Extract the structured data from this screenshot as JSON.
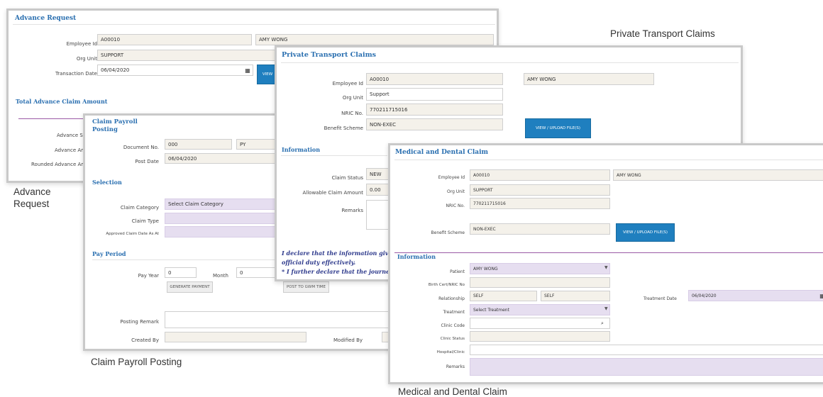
{
  "captions": {
    "advance": "Advance\nRequest",
    "private": "Private Transport Claims",
    "payroll": "Claim Payroll Posting",
    "medical": "Medical and Dental Claim"
  },
  "advance": {
    "title": "Advance Request",
    "employee_id_label": "Employee Id",
    "employee_id": "A00010",
    "employee_name": "AMY WONG",
    "org_unit_label": "Org Unit",
    "org_unit": "SUPPORT",
    "transaction_date_label": "Transaction Date",
    "transaction_date": "06/04/2020",
    "view_button": "VIEW",
    "total_section": "Total Advance Claim Amount",
    "advance_status_label": "Advance Sta",
    "advance_amount_label": "Advance Amo",
    "rounded_label": "Rounded Advance Amo"
  },
  "payroll": {
    "title_line1": "Claim Payroll",
    "title_line2": "Posting",
    "document_no_label": "Document No.",
    "document_no": "000",
    "document_type": "PY",
    "post_date_label": "Post Date",
    "post_date": "06/04/2020",
    "selection_section": "Selection",
    "claim_category_label": "Claim Category",
    "claim_category": "Select Claim Category",
    "claim_type_label": "Claim Type",
    "approved_date_label": "Approved Claim Date As At",
    "pay_period_section": "Pay Period",
    "pay_year_label": "Pay Year",
    "pay_year": "0",
    "month_label": "Month",
    "month": "0",
    "generate_button": "GENERATE PAYMENT",
    "post_button": "POST TO GWM TIME",
    "posting_remark_label": "Posting Remark",
    "created_by_label": "Created By",
    "modified_by_label": "Modified By"
  },
  "private": {
    "title": "Private Transport Claims",
    "employee_id_label": "Employee Id",
    "employee_id": "A00010",
    "employee_name": "AMY WONG",
    "org_unit_label": "Org Unit",
    "org_unit": "Support",
    "nric_label": "NRIC No.",
    "nric": "770211715016",
    "benefit_label": "Benefit Scheme",
    "benefit": "NON-EXEC",
    "view_upload": "VIEW / UPLOAD FILE(S)",
    "information_section": "Information",
    "claim_status_label": "Claim Status",
    "claim_status": "NEW",
    "allowable_label": "Allowable Claim Amount",
    "allowable": "0.00",
    "remarks_label": "Remarks",
    "declare1": "I declare that the information give",
    "declare2": "official duty effectively.",
    "declare3": "* I further declare that the journe"
  },
  "medical": {
    "title": "Medical and Dental Claim",
    "employee_id_label": "Employee Id",
    "employee_id": "A00010",
    "employee_name": "AMY WONG",
    "org_unit_label": "Org Unit",
    "org_unit": "SUPPORT",
    "nric_label": "NRIC No.",
    "nric": "770211715016",
    "benefit_label": "Benefit Scheme",
    "benefit": "NON-EXEC",
    "view_upload": "VIEW / UPLOAD FILE(S)",
    "information_section": "Information",
    "patient_label": "Patient",
    "patient": "AMY WONG",
    "birth_cert_label": "Birth Cert/NRIC No",
    "relationship_label": "Relationship",
    "relationship": "SELF",
    "relationship2": "SELF",
    "treatment_date_label": "Treatment Date",
    "treatment_date": "06/04/2020",
    "treatment_label": "Treatment",
    "treatment": "Select Treatment",
    "clinic_code_label": "Clinic Code",
    "clinic_status_label": "Clinic Status",
    "hospital_label": "Hospital/Clinic",
    "remarks_label": "Remarks"
  }
}
